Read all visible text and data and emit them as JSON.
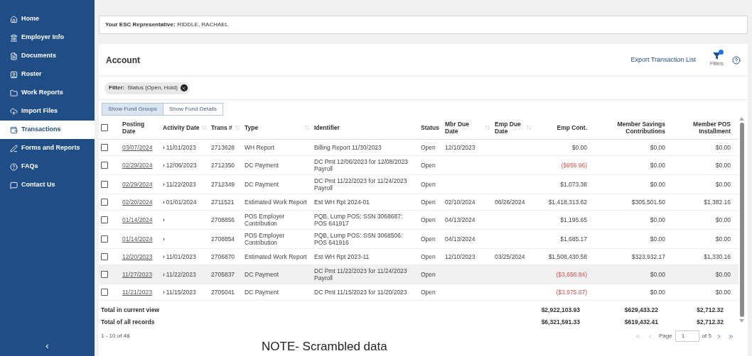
{
  "sidebar": {
    "items": [
      {
        "label": "Home",
        "selected": false
      },
      {
        "label": "Employer Info",
        "selected": false
      },
      {
        "label": "Documents",
        "selected": false
      },
      {
        "label": "Roster",
        "selected": false
      },
      {
        "label": "Work Reports",
        "selected": false
      },
      {
        "label": "Import Files",
        "selected": false
      },
      {
        "label": "Transactions",
        "selected": true
      },
      {
        "label": "Forms and Reports",
        "selected": false
      },
      {
        "label": "FAQs",
        "selected": false
      },
      {
        "label": "Contact Us",
        "selected": false
      }
    ],
    "collapse": "‹"
  },
  "representative": {
    "label": "Your ESC Representative:",
    "name": "RIDDLE, RACHAEL"
  },
  "account": {
    "title": "Account",
    "export_link": "Export Transaction List",
    "filters_label": "Filters",
    "filter_chip": {
      "label": "Filter:",
      "value": "Status (Open, Hold)"
    },
    "tabs": [
      {
        "label": "Show Fund Groups",
        "selected": true
      },
      {
        "label": "Show Fund Details",
        "selected": false
      }
    ],
    "table": {
      "all_checked": false,
      "columns": [
        {
          "label": "Posting Date",
          "sortable": false
        },
        {
          "label": "Activity Date",
          "sortable": true
        },
        {
          "label": "Trans #",
          "sortable": true
        },
        {
          "label": "Type",
          "sortable": true
        },
        {
          "label": "Identifier",
          "sortable": false
        },
        {
          "label": "Status",
          "sortable": false
        },
        {
          "label": "Mbr Due Date",
          "sortable": true
        },
        {
          "label": "Emp Due Date",
          "sortable": true
        },
        {
          "label": "Emp Cont.",
          "sortable": false
        },
        {
          "label": "Member Savings Contributions",
          "sortable": false
        },
        {
          "label": "Member POS Installment",
          "sortable": false
        }
      ],
      "rows": [
        {
          "checked": false,
          "highlighted": false,
          "posting_date": "03/07/2024",
          "arrow": "›",
          "activity_date": "11/01/2023",
          "trans": "2713628",
          "type": "WH Report",
          "identifier": "Billing Report 11/30/2023",
          "status": "Open",
          "mbr_due": "12/10/2023",
          "emp_due": "",
          "emp_cont": "$0.00",
          "negative": false,
          "savings": "$0.00",
          "pos": "$0.00"
        },
        {
          "checked": false,
          "highlighted": false,
          "posting_date": "02/29/2024",
          "arrow": "›",
          "activity_date": "12/06/2023",
          "trans": "2712350",
          "type": "DC Payment",
          "identifier": "DC Pmt 12/06/2023 for 12/08/2023 Payroll",
          "status": "Open",
          "mbr_due": "",
          "emp_due": "",
          "emp_cont": "($959.96)",
          "negative": true,
          "savings": "$0.00",
          "pos": "$0.00"
        },
        {
          "checked": false,
          "highlighted": false,
          "posting_date": "02/29/2024",
          "arrow": "›",
          "activity_date": "11/22/2023",
          "trans": "2712349",
          "type": "DC Payment",
          "identifier": "DC Pmt 11/22/2023 for 11/24/2023 Payroll",
          "status": "Open",
          "mbr_due": "",
          "emp_due": "",
          "emp_cont": "$1,073.38",
          "negative": false,
          "savings": "$0.00",
          "pos": "$0.00"
        },
        {
          "checked": false,
          "highlighted": false,
          "posting_date": "02/20/2024",
          "arrow": "›",
          "activity_date": "01/01/2024",
          "trans": "2711521",
          "type": "Estimated Work Report",
          "identifier": "Est WH Rpt 2024-01",
          "status": "Open",
          "mbr_due": "02/10/2024",
          "emp_due": "06/26/2024",
          "emp_cont": "$1,418,313.62",
          "negative": false,
          "savings": "$305,501.50",
          "pos": "$1,382.16"
        },
        {
          "checked": false,
          "highlighted": false,
          "posting_date": "01/14/2024",
          "arrow": "›",
          "activity_date": "",
          "trans": "2708856",
          "type": "POS Employer Contribution",
          "identifier": "PQB, Lump POS: SSN 3068687: POS 641917",
          "status": "Open",
          "mbr_due": "04/13/2024",
          "emp_due": "",
          "emp_cont": "$1,195.65",
          "negative": false,
          "savings": "$0.00",
          "pos": "$0.00"
        },
        {
          "checked": false,
          "highlighted": false,
          "posting_date": "01/14/2024",
          "arrow": "›",
          "activity_date": "",
          "trans": "2708854",
          "type": "POS Employer Contribution",
          "identifier": "PQB, Lump POS: SSN 3068506: POS 641916",
          "status": "Open",
          "mbr_due": "04/13/2024",
          "emp_due": "",
          "emp_cont": "$1,685.17",
          "negative": false,
          "savings": "$0.00",
          "pos": "$0.00"
        },
        {
          "checked": false,
          "highlighted": false,
          "posting_date": "12/20/2023",
          "arrow": "›",
          "activity_date": "11/01/2023",
          "trans": "2706870",
          "type": "Estimated Work Report",
          "identifier": "Est WH Rpt 2023-11",
          "status": "Open",
          "mbr_due": "12/10/2023",
          "emp_due": "03/25/2024",
          "emp_cont": "$1,508,430.58",
          "negative": false,
          "savings": "$323,932.17",
          "pos": "$1,330.16"
        },
        {
          "checked": false,
          "highlighted": true,
          "posting_date": "11/27/2023",
          "arrow": "›",
          "activity_date": "11/22/2023",
          "trans": "2705837",
          "type": "DC Payment",
          "identifier": "DC Pmt 11/22/2023 for 11/24/2023 Payroll",
          "status": "Open",
          "mbr_due": "",
          "emp_due": "",
          "emp_cont": "($3,658.84)",
          "negative": true,
          "savings": "$0.00",
          "pos": "$0.00"
        },
        {
          "checked": false,
          "highlighted": false,
          "posting_date": "11/21/2023",
          "arrow": "›",
          "activity_date": "11/15/2023",
          "trans": "2705041",
          "type": "DC Payment",
          "identifier": "DC Pmt 11/15/2023 for 11/20/2023",
          "status": "Open",
          "mbr_due": "",
          "emp_due": "",
          "emp_cont": "($3,975.67)",
          "negative": true,
          "savings": "$0.00",
          "pos": "$0.00"
        }
      ],
      "totals": [
        {
          "label": "Total in current view",
          "emp_cont": "$2,922,103.93",
          "savings": "$629,433.22",
          "pos": "$2,712.32"
        },
        {
          "label": "Total of all records",
          "emp_cont": "$6,321,591.33",
          "savings": "$619,432.41",
          "pos": "$2,712.32"
        }
      ]
    },
    "pagination": {
      "range": "1 - 10 of 48",
      "page_label": "Page",
      "page": "1",
      "of": "of 5"
    }
  },
  "note": "NOTE- Scrambled data"
}
